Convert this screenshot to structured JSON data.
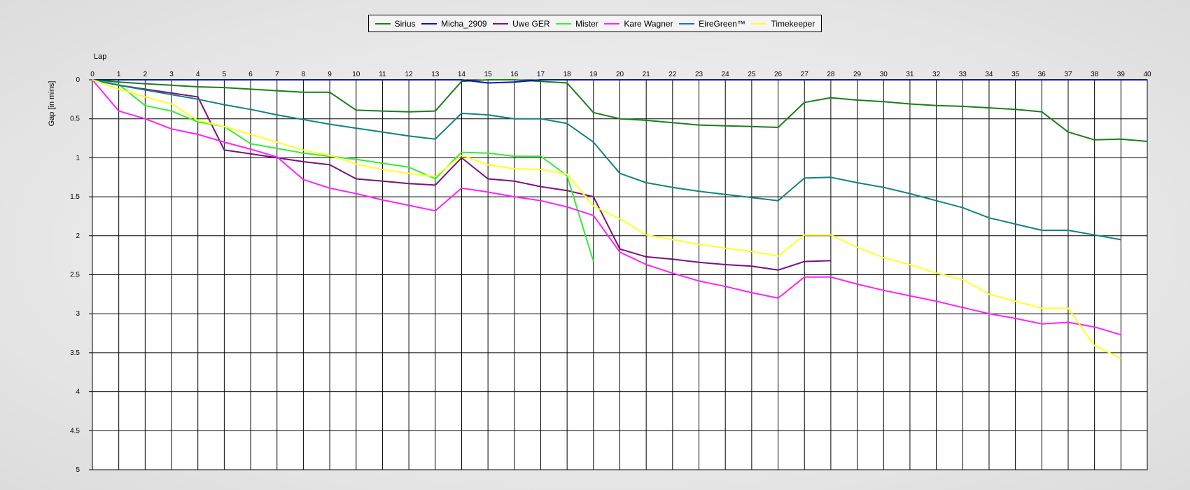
{
  "legend": [
    {
      "name": "Sirius",
      "color": "#1a7f1a"
    },
    {
      "name": "Micha_2909",
      "color": "#1010c0"
    },
    {
      "name": "Uwe GER",
      "color": "#7a1280"
    },
    {
      "name": "Mister",
      "color": "#33ee33"
    },
    {
      "name": "Kare Wagner",
      "color": "#ff22ff"
    },
    {
      "name": "EireGreen™",
      "color": "#128282"
    },
    {
      "name": "Timekeeper",
      "color": "#ffff22"
    }
  ],
  "chart_data": {
    "type": "line",
    "xlabel": "Lap",
    "ylabel": "Gap [in mins]",
    "xlim": [
      0,
      40
    ],
    "ylim": [
      0,
      5
    ],
    "y_inverted": true,
    "grid": true,
    "legend_position": "top-center",
    "x_ticks": [
      "0",
      "1",
      "2",
      "3",
      "4",
      "5",
      "6",
      "7",
      "8",
      "9",
      "10",
      "11",
      "12",
      "13",
      "14",
      "15",
      "16",
      "17",
      "18",
      "19",
      "20",
      "21",
      "22",
      "23",
      "24",
      "25",
      "26",
      "27",
      "28",
      "29",
      "30",
      "31",
      "32",
      "33",
      "34",
      "35",
      "36",
      "37",
      "38",
      "39",
      "40"
    ],
    "y_ticks": [
      "0",
      "0.5",
      "1",
      "1.5",
      "2",
      "2.5",
      "3",
      "3.5",
      "4",
      "4.5",
      "5"
    ],
    "series": [
      {
        "name": "Sirius",
        "color": "#1a7f1a",
        "x": [
          0,
          1,
          2,
          3,
          4,
          5,
          6,
          7,
          8,
          9,
          10,
          11,
          12,
          13,
          14,
          15,
          16,
          17,
          18,
          19,
          20,
          21,
          22,
          23,
          24,
          25,
          26,
          27,
          28,
          29,
          30,
          31,
          32,
          33,
          34,
          35,
          36,
          37,
          38,
          39,
          40
        ],
        "y": [
          0,
          0.03,
          0.05,
          0.07,
          0.09,
          0.1,
          0.12,
          0.14,
          0.16,
          0.16,
          0.39,
          0.4,
          0.41,
          0.4,
          0.02,
          0,
          0,
          0.02,
          0.04,
          0.42,
          0.5,
          0.52,
          0.55,
          0.58,
          0.59,
          0.6,
          0.61,
          0.29,
          0.23,
          0.26,
          0.28,
          0.31,
          0.33,
          0.34,
          0.36,
          0.38,
          0.41,
          0.67,
          0.77,
          0.76,
          0.79
        ]
      },
      {
        "name": "Micha_2909",
        "color": "#1010c0",
        "x": [
          0,
          1,
          2,
          3,
          4,
          5,
          6,
          7,
          8,
          9,
          10,
          11,
          12,
          13,
          14,
          15,
          16,
          17,
          18,
          19,
          20,
          21,
          22,
          23,
          24,
          25,
          26,
          27,
          28,
          29,
          30,
          31,
          32,
          33,
          34,
          35,
          36,
          37,
          38,
          39,
          40
        ],
        "y": [
          0,
          0,
          0,
          0,
          0,
          0,
          0,
          0,
          0,
          0,
          0,
          0,
          0,
          0,
          0,
          0.04,
          0.03,
          0,
          0,
          0,
          0,
          0,
          0,
          0,
          0,
          0,
          0,
          0,
          0,
          0,
          0,
          0,
          0,
          0,
          0,
          0,
          0,
          0,
          0,
          0,
          0
        ]
      },
      {
        "name": "Uwe GER",
        "color": "#7a1280",
        "x": [
          0,
          1,
          2,
          3,
          4,
          5,
          6,
          7,
          8,
          9,
          10,
          11,
          12,
          13,
          14,
          15,
          16,
          17,
          18,
          19,
          20,
          21,
          22,
          23,
          24,
          25,
          26,
          27,
          28
        ],
        "y": [
          0,
          0.07,
          0.12,
          0.17,
          0.22,
          0.9,
          0.95,
          1.0,
          1.05,
          1.09,
          1.27,
          1.3,
          1.33,
          1.35,
          1.0,
          1.27,
          1.3,
          1.37,
          1.42,
          1.5,
          2.17,
          2.27,
          2.3,
          2.34,
          2.37,
          2.39,
          2.44,
          2.33,
          2.32
        ]
      },
      {
        "name": "Mister",
        "color": "#33ee33",
        "x": [
          0,
          1,
          2,
          3,
          4,
          5,
          6,
          7,
          8,
          9,
          10,
          11,
          12,
          13,
          14,
          15,
          16,
          17,
          18,
          19
        ],
        "y": [
          0,
          0.06,
          0.33,
          0.4,
          0.54,
          0.6,
          0.82,
          0.88,
          0.94,
          0.98,
          1.02,
          1.07,
          1.12,
          1.27,
          0.93,
          0.94,
          0.98,
          0.98,
          1.23,
          2.33
        ]
      },
      {
        "name": "Kare Wagner",
        "color": "#ff22ff",
        "x": [
          0,
          1,
          2,
          3,
          4,
          5,
          6,
          7,
          8,
          9,
          10,
          11,
          12,
          13,
          14,
          15,
          16,
          17,
          18,
          19,
          20,
          21,
          22,
          23,
          24,
          25,
          26,
          27,
          28,
          29,
          30,
          31,
          32,
          33,
          34,
          35,
          36,
          37,
          38,
          39
        ],
        "y": [
          0,
          0.4,
          0.5,
          0.63,
          0.7,
          0.8,
          0.89,
          0.99,
          1.28,
          1.39,
          1.46,
          1.54,
          1.61,
          1.68,
          1.39,
          1.44,
          1.5,
          1.55,
          1.63,
          1.74,
          2.21,
          2.37,
          2.48,
          2.58,
          2.65,
          2.73,
          2.8,
          2.53,
          2.53,
          2.62,
          2.7,
          2.77,
          2.84,
          2.92,
          3.0,
          3.06,
          3.13,
          3.11,
          3.17,
          3.27
        ]
      },
      {
        "name": "EireGreen™",
        "color": "#128282",
        "x": [
          0,
          1,
          2,
          3,
          4,
          5,
          6,
          7,
          8,
          9,
          10,
          11,
          12,
          13,
          14,
          15,
          16,
          17,
          18,
          19,
          20,
          21,
          22,
          23,
          24,
          25,
          26,
          27,
          28,
          29,
          30,
          31,
          32,
          33,
          34,
          35,
          36,
          37,
          38,
          39
        ],
        "y": [
          0,
          0.07,
          0.13,
          0.19,
          0.25,
          0.32,
          0.38,
          0.45,
          0.51,
          0.57,
          0.62,
          0.67,
          0.72,
          0.76,
          0.43,
          0.45,
          0.5,
          0.5,
          0.56,
          0.8,
          1.2,
          1.32,
          1.38,
          1.43,
          1.47,
          1.51,
          1.55,
          1.26,
          1.25,
          1.32,
          1.38,
          1.46,
          1.55,
          1.64,
          1.77,
          1.85,
          1.93,
          1.93,
          1.99,
          2.05
        ]
      },
      {
        "name": "Timekeeper",
        "color": "#ffff22",
        "x": [
          0,
          1,
          2,
          3,
          4,
          5,
          6,
          7,
          8,
          9,
          10,
          11,
          12,
          13,
          14,
          15,
          16,
          17,
          18,
          19,
          20,
          21,
          22,
          23,
          24,
          25,
          26,
          27,
          28,
          29,
          30,
          31,
          32,
          33,
          34,
          35,
          36,
          37,
          38,
          39
        ],
        "y": [
          0,
          0.12,
          0.22,
          0.31,
          0.52,
          0.6,
          0.7,
          0.8,
          0.9,
          0.97,
          1.08,
          1.15,
          1.2,
          1.24,
          0.97,
          1.09,
          1.14,
          1.15,
          1.21,
          1.62,
          1.78,
          1.99,
          2.05,
          2.11,
          2.16,
          2.2,
          2.26,
          1.99,
          1.99,
          2.15,
          2.28,
          2.37,
          2.48,
          2.56,
          2.75,
          2.84,
          2.93,
          2.93,
          3.41,
          3.57
        ]
      }
    ]
  }
}
